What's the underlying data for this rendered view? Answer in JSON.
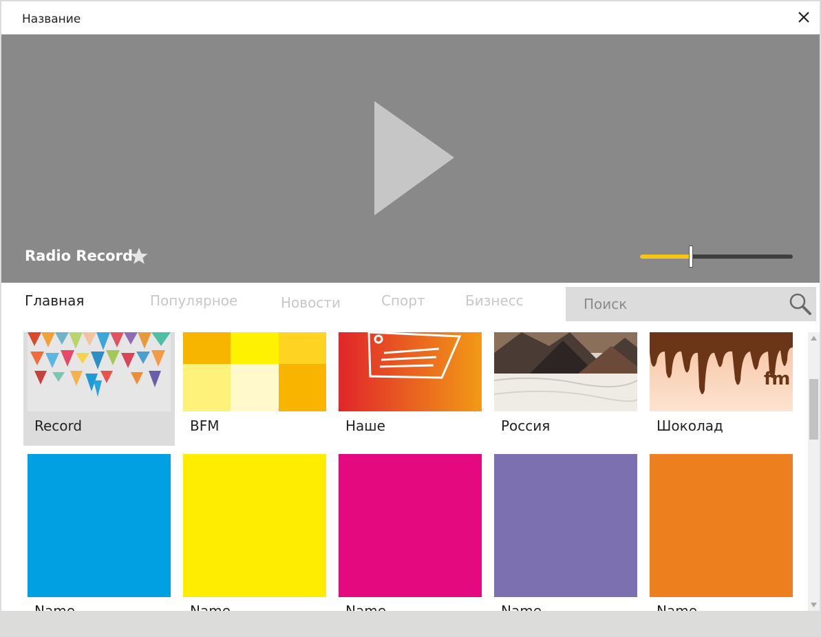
{
  "window": {
    "title": "Название"
  },
  "player": {
    "station": "Radio Record",
    "volume_percent": 33
  },
  "tabs": [
    {
      "label": "Главная",
      "active": true
    },
    {
      "label": "Популярное",
      "active": false
    },
    {
      "label": "Новости",
      "active": false
    },
    {
      "label": "Спорт",
      "active": false
    },
    {
      "label": "Бизнесс",
      "active": false
    }
  ],
  "search": {
    "placeholder": "Поиск",
    "icon": "search-icon"
  },
  "stations_row1": [
    {
      "label": "Record",
      "selected": true
    },
    {
      "label": "BFM",
      "selected": false
    },
    {
      "label": "Наше",
      "selected": false
    },
    {
      "label": "Россия",
      "selected": false
    },
    {
      "label": "Шоколад",
      "selected": false
    }
  ],
  "stations_row2": [
    {
      "label": "Name",
      "color": "#00a0e3"
    },
    {
      "label": "Name",
      "color": "#ffed00"
    },
    {
      "label": "Name",
      "color": "#e5097f"
    },
    {
      "label": "Name",
      "color": "#7d70b0"
    },
    {
      "label": "Name",
      "color": "#ee7f1e"
    }
  ],
  "choco_logo_text": "fm",
  "colors": {
    "player_bg": "#898989",
    "volume_fill": "#f5c518",
    "tab_inactive": "#c8c8c8"
  }
}
